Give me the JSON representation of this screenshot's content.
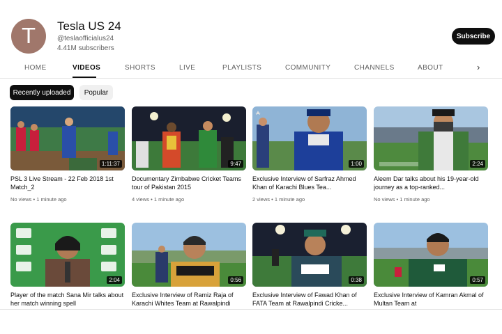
{
  "channel": {
    "avatar_letter": "T",
    "name": "Tesla US 24",
    "handle": "@teslaofficialus24",
    "subscribers": "4.41M subscribers",
    "subscribe_label": "Subscribe"
  },
  "tabs": [
    "HOME",
    "VIDEOS",
    "SHORTS",
    "LIVE",
    "PLAYLISTS",
    "COMMUNITY",
    "CHANNELS",
    "ABOUT"
  ],
  "active_tab": "VIDEOS",
  "chips": {
    "recent": "Recently uploaded",
    "popular": "Popular"
  },
  "videos": [
    {
      "title": "PSL 3 Live Stream - 22 Feb 2018 1st Match_2",
      "views": "No views",
      "time": "1 minute ago",
      "duration": "1:11:37"
    },
    {
      "title": "Documentary Zimbabwe Cricket Teams tour of Pakistan 2015",
      "views": "4 views",
      "time": "1 minute ago",
      "duration": "9:47"
    },
    {
      "title": "Exclusive Interview of Sarfraz Ahmed Khan of Karachi Blues Tea...",
      "views": "2 views",
      "time": "1 minute ago",
      "duration": "1:00"
    },
    {
      "title": "Aleem Dar talks about his 19-year-old journey as a top-ranked...",
      "views": "No views",
      "time": "1 minute ago",
      "duration": "2:24"
    },
    {
      "title": "Player of the match Sana Mir talks about her match winning spell",
      "views": "",
      "time": "",
      "duration": "2:04"
    },
    {
      "title": "Exclusive Interview of Ramiz Raja of Karachi Whites Team at Rawalpindi",
      "views": "",
      "time": "",
      "duration": "0:56"
    },
    {
      "title": "Exclusive Interview of Fawad Khan of FATA Team at Rawalpindi Cricke...",
      "views": "",
      "time": "",
      "duration": "0:38"
    },
    {
      "title": "Exclusive Interview of Kamran Akmal of Multan Team at",
      "views": "",
      "time": "",
      "duration": "0:57"
    }
  ]
}
